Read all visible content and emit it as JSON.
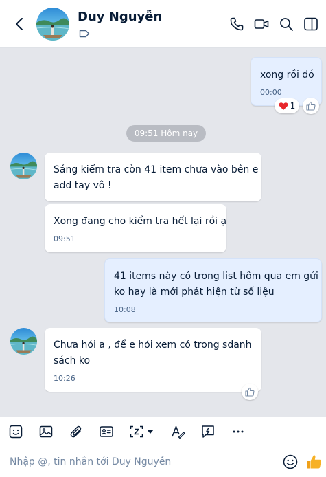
{
  "header": {
    "contact_name": "Duy Nguyễn",
    "icons": [
      "back-icon",
      "phone-icon",
      "video-call-icon",
      "search-icon",
      "sidebar-toggle-icon",
      "tag-icon"
    ]
  },
  "messages": [
    {
      "direction": "out",
      "text": [
        "xong rồi đó"
      ],
      "time": "00:00",
      "reaction": {
        "emoji": "heart",
        "count": "1"
      }
    },
    {
      "direction": "in",
      "text": [
        "Sáng kiểm tra còn 41 item chưa vào bên e",
        "add tay vô !"
      ]
    },
    {
      "direction": "in",
      "text": [
        "Xong đang cho kiểm tra hết lại rồi ạ"
      ],
      "time": "09:51"
    },
    {
      "direction": "out",
      "text": [
        "41 items này có trong list hôm qua em gửi",
        "ko hay là mới phát hiện từ số liệu"
      ],
      "time": "10:08"
    },
    {
      "direction": "in",
      "text": [
        "Chưa hỏi a , để e hỏi xem có trong sdanh",
        "sách ko"
      ],
      "time": "10:26"
    }
  ],
  "date_divider": "09:51 Hôm nay",
  "toolbar": {
    "icons": [
      "sticker-icon",
      "image-icon",
      "attachment-icon",
      "contact-card-icon",
      "screenshot-icon",
      "chevron-down-icon",
      "text-format-icon",
      "quick-message-icon",
      "more-icon"
    ]
  },
  "composer": {
    "placeholder": "Nhập @, tin nhắn tới Duy Nguyễn",
    "icons": [
      "emoji-icon",
      "thumbs-up-icon"
    ]
  },
  "colors": {
    "background": "#e4e6eb",
    "incoming_bubble": "#ffffff",
    "outgoing_bubble": "#e5efff",
    "text": "#081c36",
    "time": "#476285",
    "like_accent": "#f7b125"
  }
}
